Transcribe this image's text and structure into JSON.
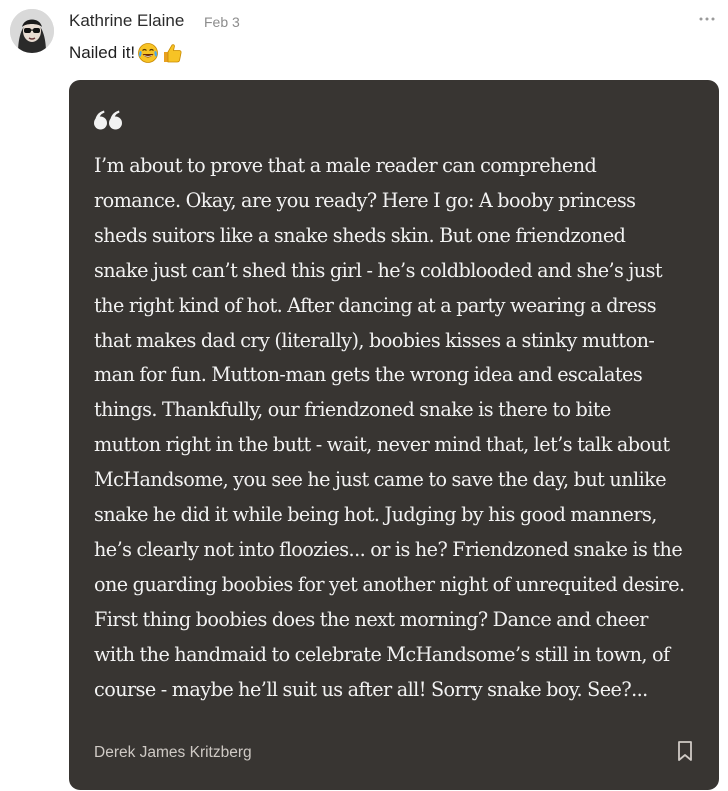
{
  "comment": {
    "author": "Kathrine Elaine",
    "date": "Feb 3",
    "text": "Nailed it!",
    "emojis": [
      "face-with-tears-of-joy",
      "thumbs-up"
    ],
    "avatar_icon": "profile-photo-sunglasses"
  },
  "quote": {
    "icon": "quote-mark-icon",
    "text": "I’m about to prove that a male reader can comprehend\nromance. Okay, are you ready? Here I go: A booby princess\nsheds suitors like a snake sheds skin. But one friendzoned\nsnake just can’t shed this girl - he’s coldblooded and she’s just\nthe right kind of hot. After dancing at a party wearing a dress\nthat makes dad cry (literally), boobies kisses a stinky mutton-\nman for fun. Mutton-man gets the wrong idea and escalates\nthings. Thankfully, our friendzoned snake is there to bite\nmutton right in the butt - wait, never mind that, let’s talk about\nMcHandsome, you see he just came to save the day, but unlike\nsnake he did it while being hot. Judging by his good manners,\nhe’s clearly not into floozies... or is he? Friendzoned snake is the\none guarding boobies for yet another night of unrequited desire.\nFirst thing boobies does the next morning? Dance and cheer\nwith the handmaid to celebrate McHandsome’s still in town, of\ncourse - maybe he’ll suit us after all! Sorry snake boy. See?...",
    "attribution": "Derek James Kritzberg"
  },
  "colors": {
    "card_background": "#383532",
    "quote_text": "#f2f2f2",
    "attribution_text": "#cfcac5",
    "author_text": "#2b2b2b",
    "date_text": "#8c8c8c"
  }
}
